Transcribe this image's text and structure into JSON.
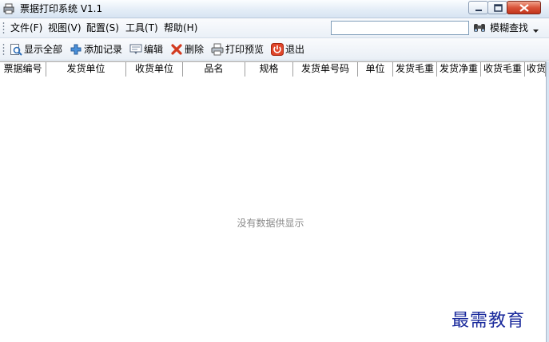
{
  "window": {
    "title": "票据打印系统 V1.1",
    "accent": "#d7e4f2",
    "close_color": "#c2351c"
  },
  "menu": {
    "items": [
      {
        "label": "文件(F)",
        "icon": null
      },
      {
        "label": "视图(V)"
      },
      {
        "label": "配置(S)"
      },
      {
        "label": "工具(T)"
      },
      {
        "label": "帮助(H)"
      }
    ]
  },
  "search": {
    "value": "",
    "placeholder": "",
    "button_label": "模糊查找",
    "button_icon": "binoculars-icon"
  },
  "toolbar": {
    "buttons": [
      {
        "label": "显示全部",
        "icon": "view-all-icon"
      },
      {
        "label": "添加记录",
        "icon": "add-icon"
      },
      {
        "label": "编辑",
        "icon": "edit-icon"
      },
      {
        "label": "删除",
        "icon": "delete-icon"
      },
      {
        "label": "打印预览",
        "icon": "print-preview-icon"
      },
      {
        "label": "退出",
        "icon": "exit-icon"
      }
    ]
  },
  "grid": {
    "columns": [
      "票据编号",
      "发货单位",
      "收货单位",
      "品名",
      "规格",
      "发货单号码",
      "单位",
      "发货毛重",
      "发货净重",
      "收货毛重",
      "收货"
    ],
    "empty_text": "没有数据供显示"
  },
  "watermark": {
    "text": "最需教育"
  }
}
